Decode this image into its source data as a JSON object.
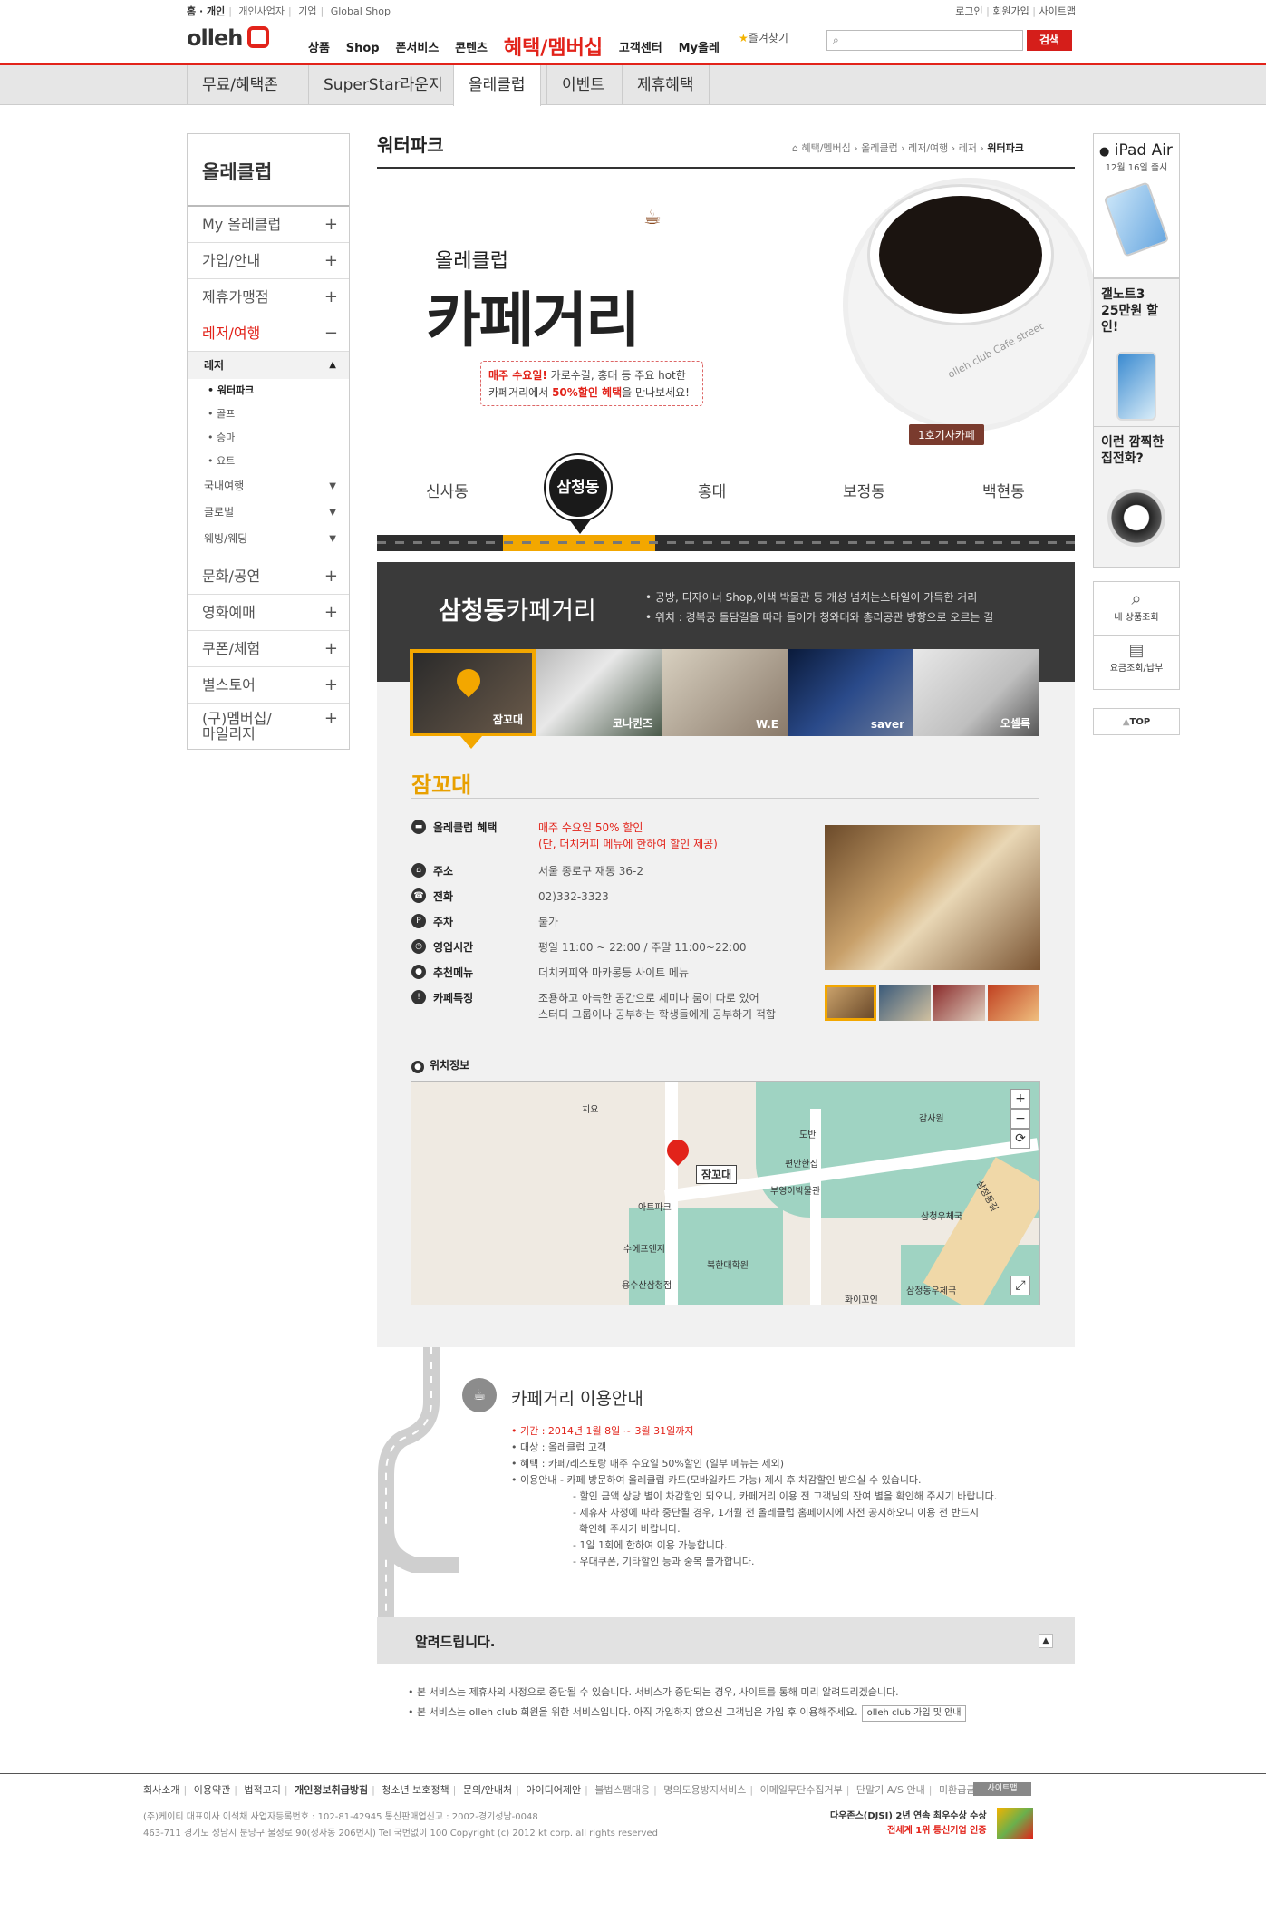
{
  "util_left": [
    "홈 · 개인",
    "개인사업자",
    "기업",
    "Global Shop"
  ],
  "util_right": [
    "로그인",
    "회원가입",
    "사이트맵"
  ],
  "logo": "olleh",
  "gnb": [
    "상품",
    "Shop",
    "폰서비스",
    "콘텐츠",
    "혜택/멤버십",
    "고객센터",
    "My올레"
  ],
  "favorites": "즐겨찾기",
  "search": {
    "placeholder": "",
    "button": "검색"
  },
  "subnav": [
    "무료/혜택존",
    "SuperStar라운지",
    "올레클럽",
    "이벤트",
    "제휴혜택"
  ],
  "lnb": {
    "title": "올레클럽",
    "items": [
      "My 올레클럽",
      "가입/안내",
      "제휴가맹점",
      "레저/여행",
      "문화/공연",
      "영화예매",
      "쿠폰/체험",
      "별스토어",
      "(구)멤버십/\n마일리지"
    ],
    "sub_head": "레저",
    "sub_items": [
      "워터파크",
      "골프",
      "승마",
      "요트"
    ],
    "groups": [
      "국내여행",
      "글로벌",
      "웨빙/웨딩"
    ]
  },
  "page_title": "워터파크",
  "breadcrumb": [
    "혜택/멤버십",
    "올레클럽",
    "레저/여행",
    "레저",
    "워터파크"
  ],
  "hero": {
    "sub": "올레클럽",
    "title": "카페거리",
    "desc1_red": "매주 수요일!",
    "desc1": " 가로수길, 홍대 등 주요 hot한",
    "desc2a": "카페거리에서 ",
    "desc2_red": "50%할인 혜택",
    "desc2b": "을 만나보세요!",
    "sign": "1호기사카페",
    "cup_text": "olleh club Café street"
  },
  "districts": [
    "신사동",
    "삼청동",
    "홍대",
    "보정동",
    "백현동"
  ],
  "banner": {
    "title_bold": "삼청동",
    "title": "카페거리",
    "info1": "• 공방, 디자이너 Shop,이색 박물관 등 개성 넘치는스타일이 가득한 거리",
    "info2": "• 위치 : 경복궁 돌담길을 따라 들어가 청와대와 총리공관 방향으로 오르는 길"
  },
  "cafes": [
    "잠꼬대",
    "코나퀸즈",
    "W.E",
    "saver",
    "오셀록"
  ],
  "cafe": {
    "name": "잠꼬대",
    "rows": [
      {
        "k": "올레클럽 혜택",
        "v": "매주 수요일 50% 할인",
        "v2": "(단, 더치커피 메뉴에 한하여 할인 제공)",
        "red": true,
        "icon": "card-icon"
      },
      {
        "k": "주소",
        "v": "서울 종로구 재동 36-2",
        "icon": "home-icon"
      },
      {
        "k": "전화",
        "v": "02)332-3323",
        "icon": "phone-icon"
      },
      {
        "k": "주차",
        "v": "불가",
        "icon": "parking-icon"
      },
      {
        "k": "영업시간",
        "v": "평일 11:00 ~ 22:00 / 주말 11:00~22:00",
        "icon": "clock-icon"
      },
      {
        "k": "추천메뉴",
        "v": "더치커피와 마카롱등 사이트 메뉴",
        "icon": "drop-icon"
      },
      {
        "k": "카페특징",
        "v": "조용하고 아늑한 공간으로 세미나 룸이 따로 있어",
        "v2": "스터디 그룹이나 공부하는 학생들에게 공부하기 적합",
        "icon": "exclaim-icon"
      }
    ]
  },
  "location_title": "위치정보",
  "map": {
    "labels": [
      "치요",
      "도반",
      "감사원",
      "편안한집",
      "부영이박물관",
      "아트파크",
      "수에프엔지",
      "북한대학원",
      "용수산삼청점",
      "삼청우체국",
      "삼청동우체국",
      "화이꼬인",
      "삼청동길"
    ],
    "tag": "잠꼬대",
    "zoom_in": "+",
    "zoom_out": "−",
    "reset": "⟳",
    "full": "⤢"
  },
  "guide": {
    "title": "카페거리 이용안내",
    "period": "• 기간 : 2014년 1월 8일 ~ 3월 31일까지",
    "target": "• 대상 : 올레클럽 고객",
    "benefit": "• 혜택 : 카페/레스토랑 매주 수요일 50%할인 (일부 메뉴는 제외)",
    "usage": [
      "• 이용안내  - 카페 방문하여 올레클럽 카드(모바일카드 가능) 제시 후 차감할인 받으실 수 있습니다.",
      "- 할인 금액 상당 별이 차감할인 되오니, 카페거리 이용 전 고객님의 잔여 별을 확인해 주시기 바랍니다.",
      "- 제휴사 사정에 따라 중단될 경우, 1개월 전 올레클럽  홈페이지에 사전 공지하오니 이용 전 반드시",
      "  확인해 주시기 바랍니다.",
      "- 1일 1회에 한하여 이용 가능합니다.",
      "- 우대쿠폰, 기타할인 등과 중복 불가합니다."
    ]
  },
  "notice": {
    "title": "알려드립니다.",
    "line1": "• 본 서비스는 제휴사의 사정으로 중단될 수 있습니다. 서비스가 중단되는 경우, 사이트를 통해 미리 알려드리겠습니다.",
    "line2": "• 본 서비스는 olleh club 회원을 위한 서비스입니다. 아직 가입하지 않으신 고객님은 가입 후 이용해주세요.",
    "button": "olleh club 가입 및 안내"
  },
  "right": {
    "ipad_title": "iPad Air",
    "ipad_sub": "12월 16일 출시",
    "note_title": "갤노트3\n25만원 할인!",
    "phone_title": "이런 깜찍한\n집전화?",
    "btn1": "내 상품조회",
    "btn2": "요금조회/납부",
    "top": "TOP"
  },
  "footer": {
    "links": [
      "회사소개",
      "이용약관",
      "법적고지",
      "개인정보취급방침",
      "청소년 보호정책",
      "문의/안내처",
      "아이디어제안"
    ],
    "links_light": [
      "불법스팸대응",
      "명의도용방지서비스",
      "이메일무단수집거부",
      "단말기 A/S 안내",
      "미환급금조회"
    ],
    "sitemap": "사이트맵",
    "copy1": "(주)케이티 대표이사 이석채   사업자등록번호 : 102-81-42945   통신판매업신고 : 2002-경기성남-0048",
    "copy2": "463-711 경기도 성남시 분당구 불정로 90(정자동 206번지) Tel 국번없이 100 Copyright (c) 2012 kt corp. all rights reserved",
    "award1": "다우존스(DJSI) 2년 연속 최우수상 수상",
    "award2": "전세계 1위 통신기업 인증"
  },
  "colors": {
    "brand_red": "#e2231a",
    "accent_yellow": "#f3a700",
    "dark_banner": "#3a3a3a"
  }
}
